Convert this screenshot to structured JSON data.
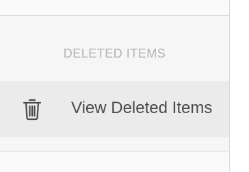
{
  "section": {
    "header": "DELETED ITEMS"
  },
  "menu": {
    "items": [
      {
        "label": "View Deleted Items",
        "icon": "trash-icon"
      }
    ]
  },
  "colors": {
    "header_text": "#b3b3b3",
    "item_text": "#4a4a4a",
    "item_background": "#ebebeb",
    "panel_background": "#f6f6f6"
  }
}
